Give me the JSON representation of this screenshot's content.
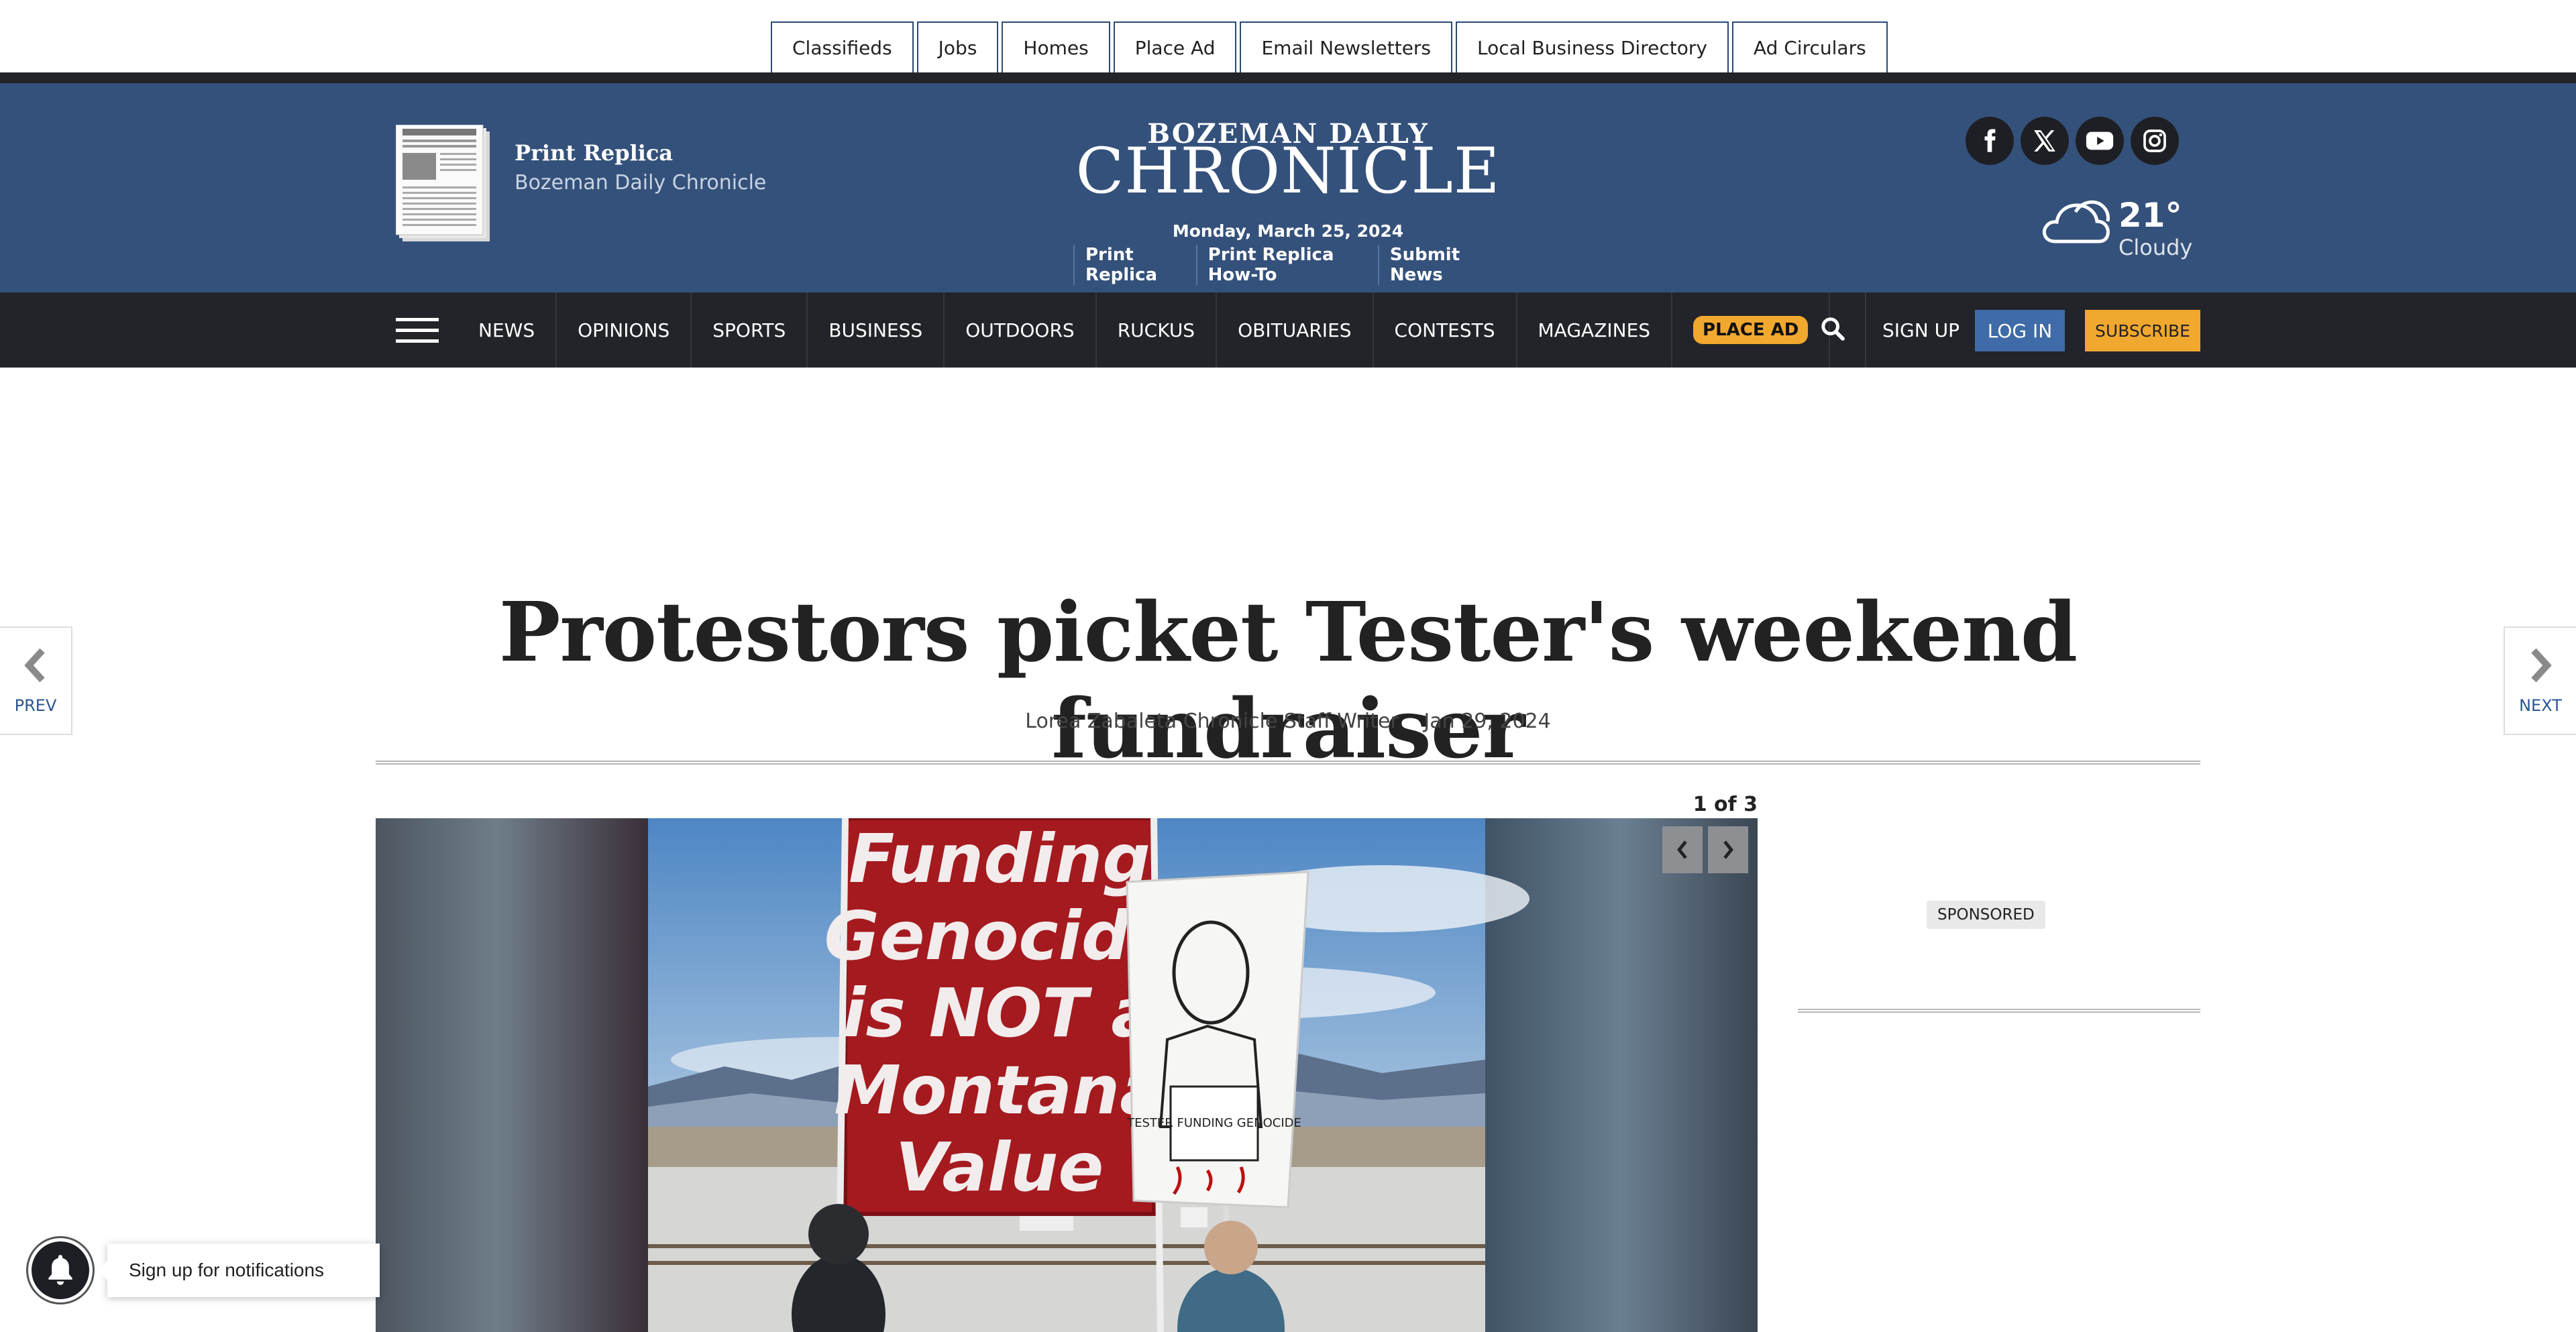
{
  "utility_links": [
    "Classifieds",
    "Jobs",
    "Homes",
    "Place Ad",
    "Email Newsletters",
    "Local Business Directory",
    "Ad Circulars"
  ],
  "masthead": {
    "replica_title": "Print Replica",
    "replica_subtitle": "Bozeman Daily Chronicle",
    "logo_top": "BOZEMAN DAILY",
    "logo_main": "CHRONICLE",
    "date": "Monday, March 25, 2024",
    "sublinks": [
      "Print Replica",
      "Print Replica How-To",
      "Submit News"
    ],
    "social_icons": [
      "facebook-icon",
      "x-icon",
      "youtube-icon",
      "instagram-icon"
    ],
    "weather": {
      "temp": "21°",
      "condition": "Cloudy"
    }
  },
  "nav": {
    "items": [
      "NEWS",
      "OPINIONS",
      "SPORTS",
      "BUSINESS",
      "OUTDOORS",
      "RUCKUS",
      "OBITUARIES",
      "CONTESTS",
      "MAGAZINES"
    ],
    "place_ad": "PLACE AD",
    "sign_up": "SIGN UP",
    "log_in": "LOG IN",
    "subscribe": "SUBSCRIBE"
  },
  "side_nav": {
    "prev": "PREV",
    "next": "NEXT"
  },
  "article": {
    "headline": "Protestors picket Tester's weekend fundraiser",
    "author": "Lorea Zabaleta Chronicle Staff Writer",
    "date": "Jan 29, 2024",
    "gallery_counter": "1 of 3",
    "photo": {
      "red_banner": [
        "Funding",
        "Genocide",
        "is NOT a",
        "Montana",
        "Value"
      ],
      "white_banner": "TESTER FUNDING GENOCIDE"
    }
  },
  "sidebar": {
    "sponsored": "SPONSORED"
  },
  "notification": {
    "label": "Sign up for notifications"
  },
  "colors": {
    "masthead": "#34517b",
    "nav": "#222429",
    "accent_orange": "#f1a82f",
    "login_blue": "#3f6ba8"
  }
}
